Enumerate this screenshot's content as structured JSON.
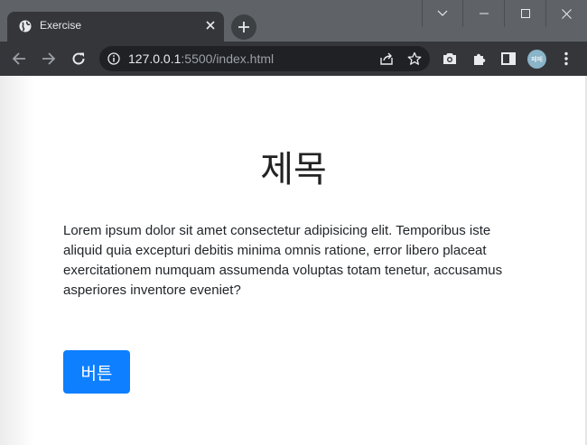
{
  "browser": {
    "tab": {
      "title": "Exercise"
    },
    "address_bar": {
      "host": "127.0.0.1",
      "path": ":5500/index.html"
    },
    "profile_initials": "페페"
  },
  "page": {
    "heading": "제목",
    "paragraph": "Lorem ipsum dolor sit amet consectetur adipisicing elit. Temporibus iste aliquid quia excepturi debitis minima omnis ratione, error libero placeat exercitationem numquam assumenda voluptas totam tenetur, accusamus asperiores inventore eveniet?",
    "button_label": "버튼"
  },
  "colors": {
    "button": "#0d7fff",
    "chrome_frame": "#5f6368",
    "chrome_toolbar": "#35363a"
  }
}
